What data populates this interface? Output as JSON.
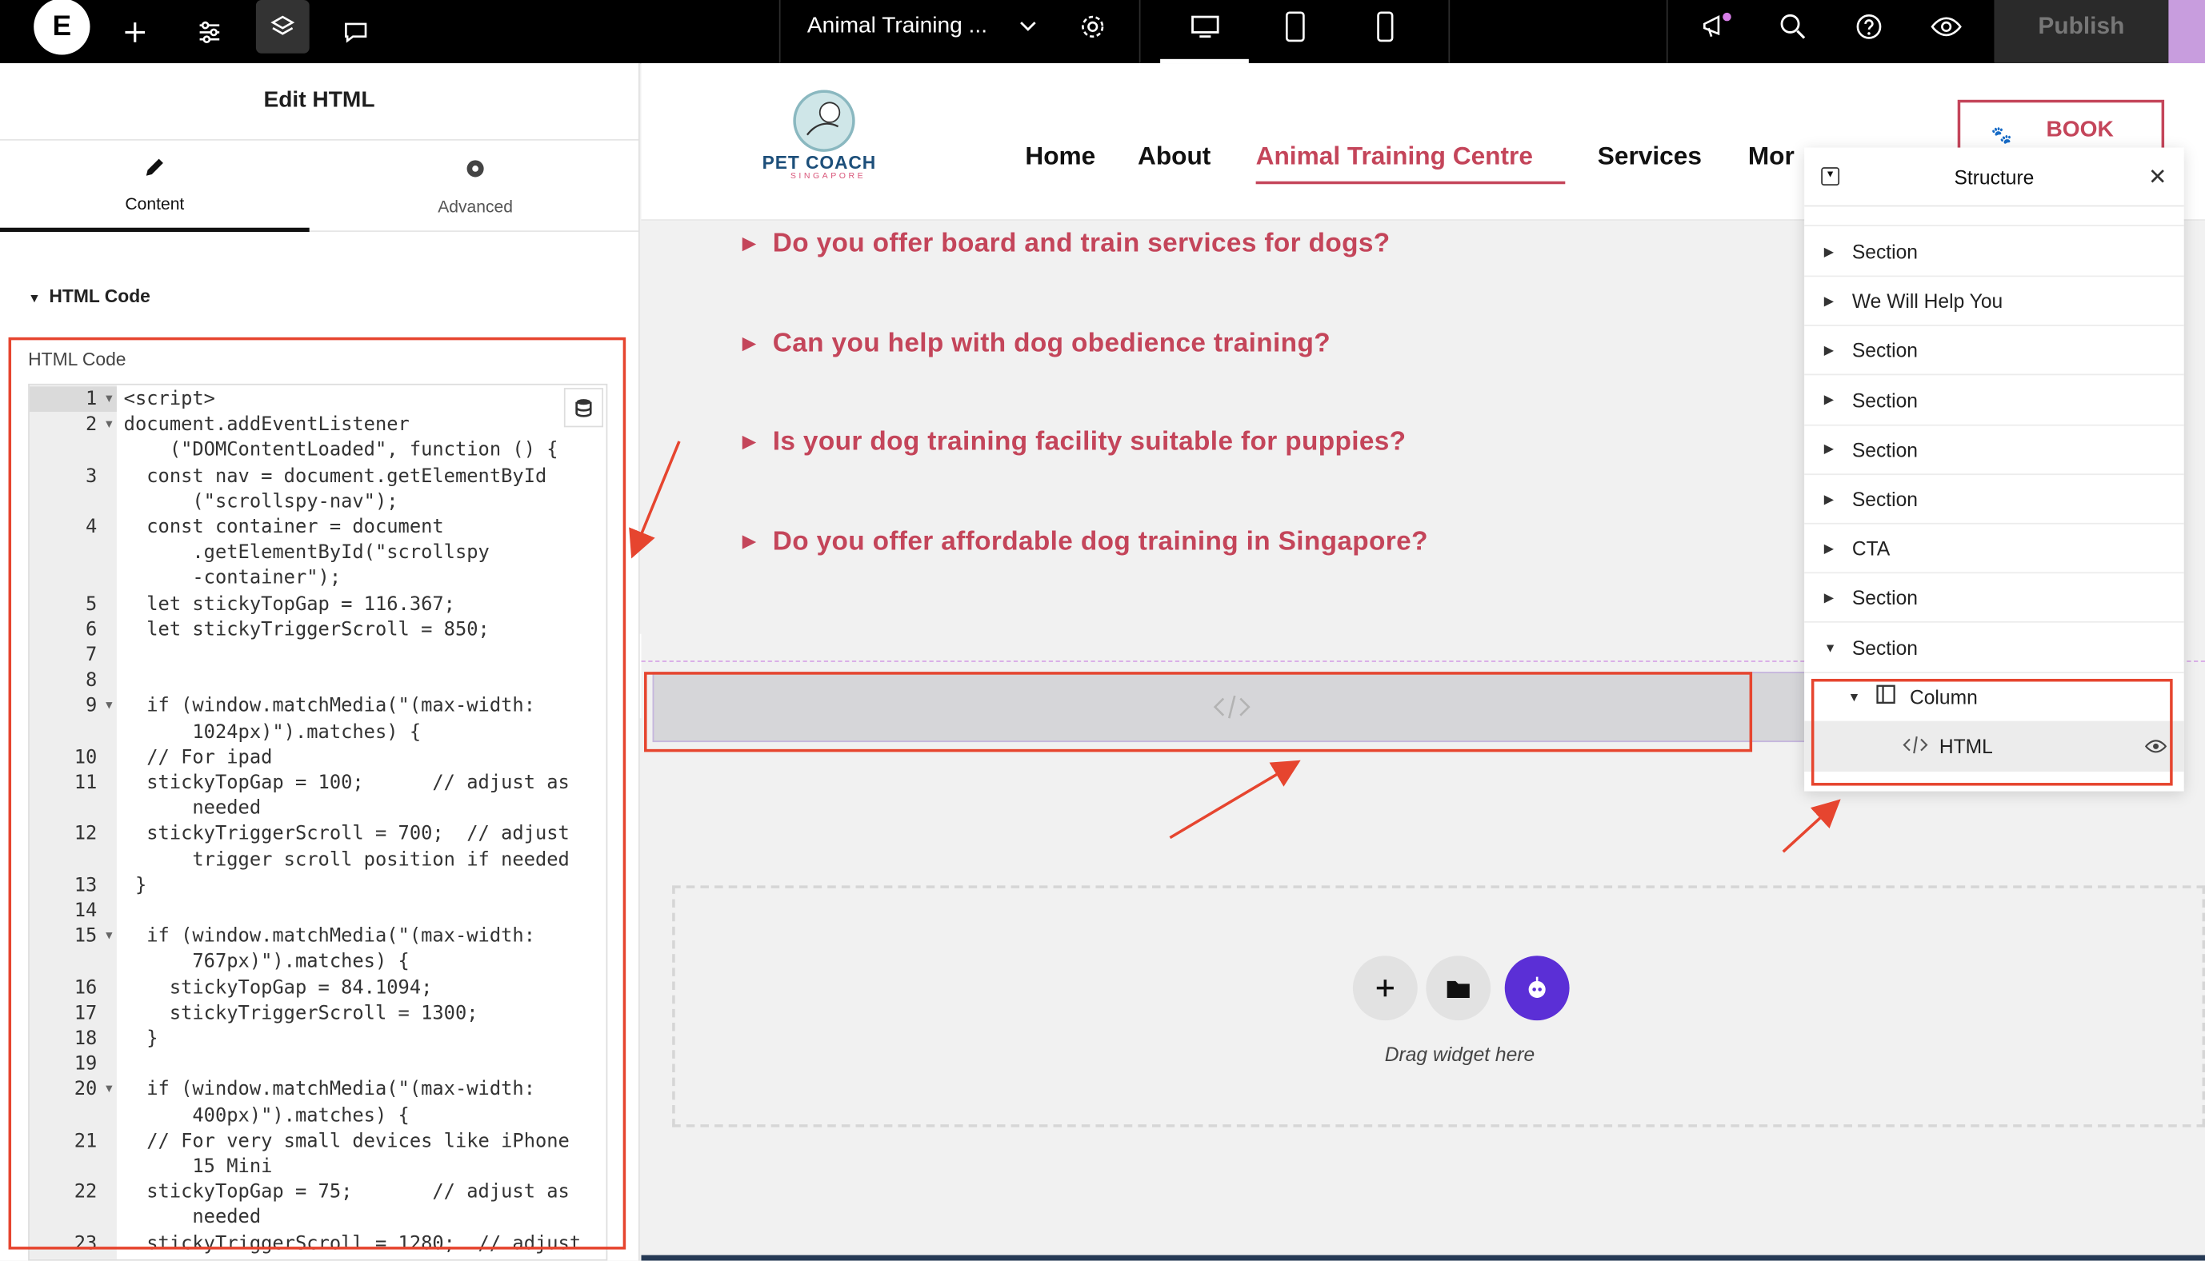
{
  "topbar": {
    "logo": "E",
    "page_title": "Animal Training ...",
    "publish": "Publish",
    "colors": {
      "bg": "#000000",
      "notify_dot": "#d77ee8"
    }
  },
  "panel": {
    "title": "Edit HTML",
    "tabs": [
      {
        "label": "Content",
        "icon": "pencil-icon"
      },
      {
        "label": "Advanced",
        "icon": "gear-icon"
      }
    ],
    "section_title": "HTML Code",
    "code_label": "HTML Code",
    "code_lines": [
      {
        "n": "1",
        "text": "<script>",
        "fold": true
      },
      {
        "n": "2",
        "text": "document.addEventListener",
        "fold": true
      },
      {
        "n": "",
        "text": "    (\"DOMContentLoaded\", function () {"
      },
      {
        "n": "3",
        "text": "  const nav = document.getElementById"
      },
      {
        "n": "",
        "text": "      (\"scrollspy-nav\");"
      },
      {
        "n": "4",
        "text": "  const container = document"
      },
      {
        "n": "",
        "text": "      .getElementById(\"scrollspy"
      },
      {
        "n": "",
        "text": "      -container\");"
      },
      {
        "n": "5",
        "text": "  let stickyTopGap = 116.367;"
      },
      {
        "n": "6",
        "text": "  let stickyTriggerScroll = 850;"
      },
      {
        "n": "7",
        "text": ""
      },
      {
        "n": "8",
        "text": ""
      },
      {
        "n": "9",
        "text": "  if (window.matchMedia(\"(max-width:",
        "fold": true
      },
      {
        "n": "",
        "text": "      1024px)\").matches) {"
      },
      {
        "n": "10",
        "text": "  // For ipad"
      },
      {
        "n": "11",
        "text": "  stickyTopGap = 100;      // adjust as"
      },
      {
        "n": "",
        "text": "      needed"
      },
      {
        "n": "12",
        "text": "  stickyTriggerScroll = 700;  // adjust"
      },
      {
        "n": "",
        "text": "      trigger scroll position if needed"
      },
      {
        "n": "13",
        "text": " }"
      },
      {
        "n": "14",
        "text": ""
      },
      {
        "n": "15",
        "text": "  if (window.matchMedia(\"(max-width:",
        "fold": true
      },
      {
        "n": "",
        "text": "      767px)\").matches) {"
      },
      {
        "n": "16",
        "text": "    stickyTopGap = 84.1094;"
      },
      {
        "n": "17",
        "text": "    stickyTriggerScroll = 1300;"
      },
      {
        "n": "18",
        "text": "  }"
      },
      {
        "n": "19",
        "text": ""
      },
      {
        "n": "20",
        "text": "  if (window.matchMedia(\"(max-width:",
        "fold": true
      },
      {
        "n": "",
        "text": "      400px)\").matches) {"
      },
      {
        "n": "21",
        "text": "  // For very small devices like iPhone"
      },
      {
        "n": "",
        "text": "      15 Mini"
      },
      {
        "n": "22",
        "text": "  stickyTopGap = 75;       // adjust as"
      },
      {
        "n": "",
        "text": "      needed"
      },
      {
        "n": "23",
        "text": "  stickyTriggerScroll = 1280;  // adjust"
      }
    ]
  },
  "site": {
    "logo_text": "PET COACH",
    "logo_sub": "SINGAPORE",
    "nav": [
      "Home",
      "About",
      "Animal Training Centre",
      "Services",
      "Mor"
    ],
    "book": "BOOK",
    "faqs": [
      "Do you offer board and train services for dogs?",
      "Can you help with dog obedience training?",
      "Is your dog training facility suitable for puppies?",
      "Do you offer affordable dog training in Singapore?"
    ],
    "drop_text": "Drag widget here",
    "colors": {
      "accent": "#c4455a",
      "ai_button": "#5b2fd6"
    }
  },
  "structure": {
    "title": "Structure",
    "items": [
      {
        "label": "Section",
        "level": 0,
        "caret": "right"
      },
      {
        "label": "We Will Help You",
        "level": 0,
        "caret": "right"
      },
      {
        "label": "Section",
        "level": 0,
        "caret": "right"
      },
      {
        "label": "Section",
        "level": 0,
        "caret": "right"
      },
      {
        "label": "Section",
        "level": 0,
        "caret": "right"
      },
      {
        "label": "Section",
        "level": 0,
        "caret": "right"
      },
      {
        "label": "CTA",
        "level": 0,
        "caret": "right"
      },
      {
        "label": "Section",
        "level": 0,
        "caret": "right"
      },
      {
        "label": "Section",
        "level": 0,
        "caret": "down"
      },
      {
        "label": "Column",
        "level": 1,
        "caret": "down"
      },
      {
        "label": "HTML",
        "level": 2,
        "caret": ""
      }
    ]
  }
}
